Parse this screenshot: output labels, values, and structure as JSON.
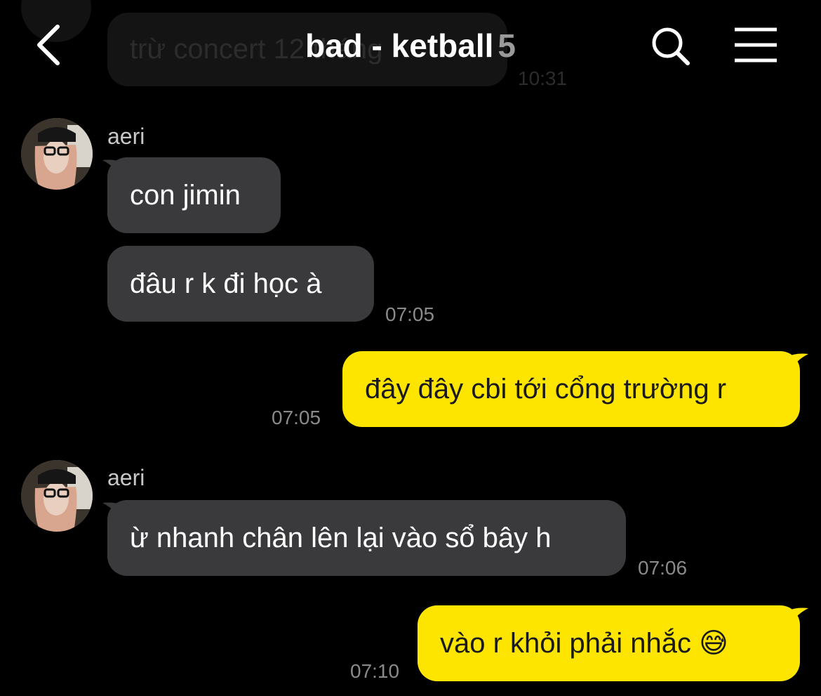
{
  "previous": {
    "text": "trừ concert 12 tháng",
    "time": "10:31"
  },
  "header": {
    "title": "bad - ketball",
    "member_count": "5"
  },
  "colors": {
    "background": "#000000",
    "incoming_bubble": "#3a3a3c",
    "outgoing_bubble": "#fde500",
    "timestamp": "#8a8a8a"
  },
  "messages": [
    {
      "sender": "aeri",
      "text": "con jimin"
    },
    {
      "sender": "aeri",
      "text": "đâu r k đi học à",
      "time": "07:05"
    },
    {
      "sender": "me",
      "text": "đây đây cbi tới cổng trường r",
      "time": "07:05"
    },
    {
      "sender": "aeri",
      "text": "ừ nhanh chân lên lại vào sổ bây h",
      "time": "07:06"
    },
    {
      "sender": "me",
      "text": "vào r khỏi phải nhắc 😅",
      "time": "07:10"
    }
  ]
}
